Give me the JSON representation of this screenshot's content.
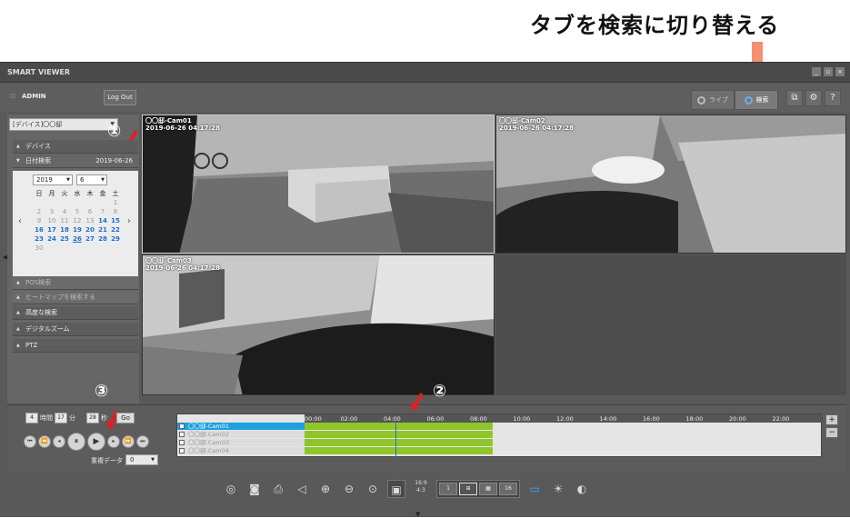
{
  "annotation": {
    "title": "タブを検索に切り替える",
    "marker1": "①",
    "marker2": "②",
    "marker3": "③"
  },
  "app": {
    "title": "SMART VIEWER",
    "user_label": "ID",
    "user_name": "ADMIN",
    "logout": "Log Out"
  },
  "tabs": [
    {
      "label": "ライブ",
      "icon": "live-icon",
      "active": false
    },
    {
      "label": "検索",
      "icon": "search-icon",
      "active": true
    }
  ],
  "sidebar": {
    "device_select": "[デバイス]〇〇邸",
    "sections": {
      "device": "デバイス",
      "date_search": "日付検索",
      "date_value": "2019-06-26",
      "pos": "POS検索",
      "heatmap": "ヒートマップを検索する",
      "advanced": "高度な検索",
      "digital_zoom": "デジタルズーム",
      "ptz": "PTZ"
    },
    "calendar": {
      "year": "2019",
      "month": "6",
      "weekdays": [
        "日",
        "月",
        "火",
        "水",
        "木",
        "金",
        "土"
      ],
      "days": [
        {
          "d": "",
          "c": ""
        },
        {
          "d": "",
          "c": ""
        },
        {
          "d": "",
          "c": ""
        },
        {
          "d": "",
          "c": ""
        },
        {
          "d": "",
          "c": ""
        },
        {
          "d": "",
          "c": ""
        },
        {
          "d": "1",
          "c": "d-na"
        },
        {
          "d": "2",
          "c": "d-na"
        },
        {
          "d": "3",
          "c": "d-na"
        },
        {
          "d": "4",
          "c": "d-na"
        },
        {
          "d": "5",
          "c": "d-na"
        },
        {
          "d": "6",
          "c": "d-na"
        },
        {
          "d": "7",
          "c": "d-na"
        },
        {
          "d": "8",
          "c": "d-na"
        },
        {
          "d": "9",
          "c": "d-na"
        },
        {
          "d": "10",
          "c": "d-na"
        },
        {
          "d": "11",
          "c": "d-na"
        },
        {
          "d": "12",
          "c": "d-na"
        },
        {
          "d": "13",
          "c": "d-na"
        },
        {
          "d": "14",
          "c": "d-hi"
        },
        {
          "d": "15",
          "c": "d-hi"
        },
        {
          "d": "16",
          "c": "d-hi"
        },
        {
          "d": "17",
          "c": "d-hi"
        },
        {
          "d": "18",
          "c": "d-hi"
        },
        {
          "d": "19",
          "c": "d-hi"
        },
        {
          "d": "20",
          "c": "d-hi"
        },
        {
          "d": "21",
          "c": "d-hi"
        },
        {
          "d": "22",
          "c": "d-hi"
        },
        {
          "d": "23",
          "c": "d-hi"
        },
        {
          "d": "24",
          "c": "d-hi"
        },
        {
          "d": "25",
          "c": "d-hi"
        },
        {
          "d": "26",
          "c": "d-sel"
        },
        {
          "d": "27",
          "c": "d-hi"
        },
        {
          "d": "28",
          "c": "d-hi"
        },
        {
          "d": "29",
          "c": "d-hi"
        },
        {
          "d": "30",
          "c": "d-na"
        }
      ]
    }
  },
  "cameras": [
    {
      "name": "〇〇邸-Cam01",
      "timestamp": "2019-06-26 04:17:28"
    },
    {
      "name": "〇〇邸-Cam02",
      "timestamp": "2019-06-26 04:17:28"
    },
    {
      "name": "〇〇邸-Cam03",
      "timestamp": "2019-06-26 04:17:28"
    }
  ],
  "time_controls": {
    "hour": "4",
    "hour_label": "時間",
    "minute": "17",
    "minute_label": "分",
    "second": "28",
    "second_label": "秒",
    "go": "Go"
  },
  "overlap": {
    "label": "重複データ",
    "value": "0"
  },
  "timeline": {
    "hours": [
      "00:00",
      "02:00",
      "04:00",
      "06:00",
      "08:00",
      "10:00",
      "12:00",
      "14:00",
      "16:00",
      "18:00",
      "20:00",
      "22:00"
    ],
    "channels": [
      "〇〇邸-Cam01",
      "〇〇邸-Cam02",
      "〇〇邸-Cam03",
      "〇〇邸-Cam04"
    ],
    "recorded_hours": [
      0,
      8.7
    ]
  },
  "toolbar": {
    "aspect_top": "16:9",
    "aspect_bottom": "4:3",
    "layout_1": "1",
    "layout_16": "16"
  }
}
